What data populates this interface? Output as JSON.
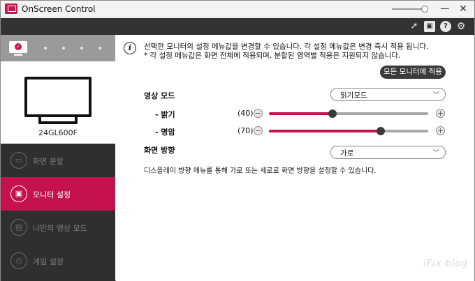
{
  "window": {
    "title": "OnScreen Control",
    "minimize_glyph": "—",
    "close_glyph": "✕"
  },
  "header": {
    "icons": [
      "cursor-icon",
      "screen-split-icon",
      "help-icon",
      "settings-gear-icon"
    ]
  },
  "sidebar": {
    "monitor_model": "24GL600F",
    "menu": [
      {
        "label": "화면 분할",
        "icon": "screen-split-icon",
        "active": false
      },
      {
        "label": "모니터 설정",
        "icon": "monitor-settings-icon",
        "active": true
      },
      {
        "label": "나만의 영상 모드",
        "icon": "picture-mode-icon",
        "active": false
      },
      {
        "label": "게임 설정",
        "icon": "gamepad-icon",
        "active": false
      }
    ]
  },
  "main": {
    "info_line1": "선택한 모니터의 설정 메뉴값을 변경할 수 있습니다. 각 설정 메뉴값은 변경 즉시 적용 됩니다.",
    "info_line2": "* 각 설정 메뉴값은 화면 전체에 적용되며, 분할된 영역별 적용은 지원되지 않습니다.",
    "apply_all_label": "모든 모니터에 적용",
    "picture_mode": {
      "label": "영상 모드",
      "selected": "읽기모드"
    },
    "brightness": {
      "label": "- 밝기",
      "value_text": "(40)",
      "value": 40,
      "max": 100
    },
    "contrast": {
      "label": "- 명암",
      "value_text": "(70)",
      "value": 70,
      "max": 100
    },
    "orientation": {
      "label": "화면 방향",
      "selected": "가로",
      "description": "디스플레이 방향 메뉴를 통해 가로 또는 세로로 화면 방향을 설정할 수 있습니다."
    }
  },
  "watermark": "iFix blog",
  "colors": {
    "accent": "#c5124c",
    "sidebar_bg": "#2f2f2f",
    "header_bg": "#333333"
  }
}
